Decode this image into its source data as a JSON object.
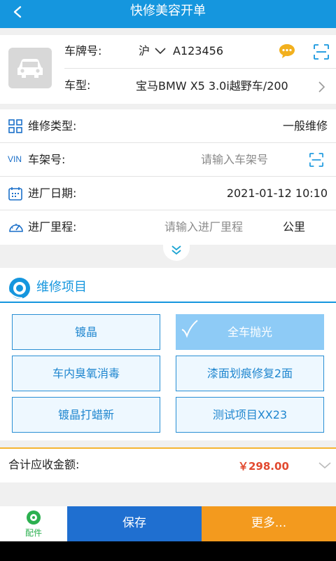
{
  "header": {
    "title": "快修美容开单"
  },
  "vehicle": {
    "plate_label": "车牌号:",
    "province": "沪",
    "plate_number": "A123456",
    "model_label": "车型:",
    "model_value": "宝马BMW X5 3.0i越野车/200"
  },
  "info": {
    "repair_type_label": "维修类型:",
    "repair_type_value": "一般维修",
    "vin_icon_text": "VIN",
    "vin_label": "车架号:",
    "vin_placeholder": "请输入车架号",
    "date_label": "进厂日期:",
    "date_value": "2021-01-12 10:10",
    "mileage_label": "进厂里程:",
    "mileage_placeholder": "请输入进厂里程",
    "mileage_unit": "公里"
  },
  "projects": {
    "title": "维修项目",
    "items": [
      {
        "label": "镀晶",
        "selected": false
      },
      {
        "label": "全车抛光",
        "selected": true
      },
      {
        "label": "车内臭氧消毒",
        "selected": false
      },
      {
        "label": "漆面划痕修复2面",
        "selected": false
      },
      {
        "label": "镀晶打蜡新",
        "selected": false
      },
      {
        "label": "测试项目XX23",
        "selected": false
      }
    ]
  },
  "total": {
    "label": "合计应收金额:",
    "value": "￥298.00"
  },
  "bottom": {
    "parts_label": "配件",
    "save_label": "保存",
    "more_label": "更多..."
  },
  "colors": {
    "primary": "#1596de",
    "accent_orange": "#f39a1e",
    "save_blue": "#1f6fd0",
    "price_red": "#e2492f",
    "selected_fill": "#8ecbf6"
  }
}
